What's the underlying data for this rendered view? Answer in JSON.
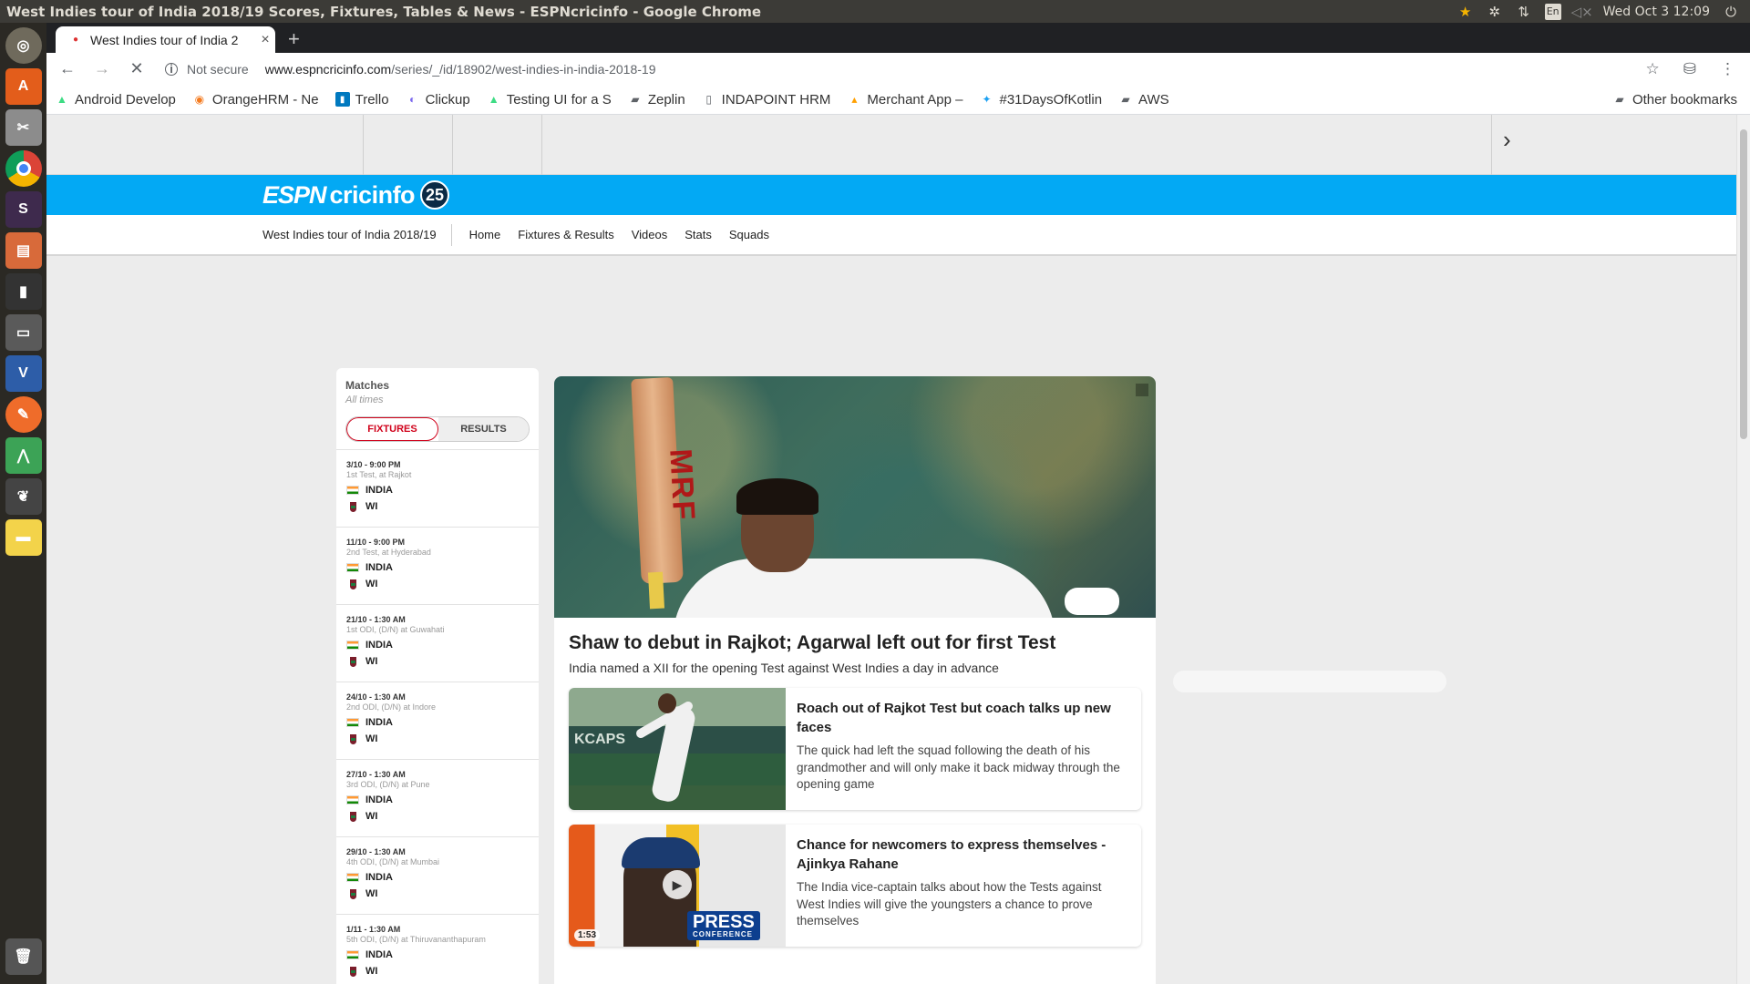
{
  "window_title": "West Indies tour of India 2018/19 Scores, Fixtures, Tables & News - ESPNcricinfo - Google Chrome",
  "system_tray": {
    "lang": "En",
    "clock": "Wed Oct  3 12:09"
  },
  "browser": {
    "tab_title": "West Indies tour of India 2",
    "security_label": "Not secure",
    "url_host": "www.espncricinfo.com",
    "url_path": "/series/_/id/18902/west-indies-in-india-2018-19",
    "bookmarks": [
      {
        "label": "Android Develop",
        "icon": "android-icon"
      },
      {
        "label": "OrangeHRM - Ne",
        "icon": "orangehrm-icon"
      },
      {
        "label": "Trello",
        "icon": "trello-icon"
      },
      {
        "label": "Clickup",
        "icon": "clickup-icon"
      },
      {
        "label": "Testing UI for a S",
        "icon": "android-icon"
      },
      {
        "label": "Zeplin",
        "icon": "folder-icon"
      },
      {
        "label": "INDAPOINT HRM",
        "icon": "page-icon"
      },
      {
        "label": "Merchant App –",
        "icon": "firebase-icon"
      },
      {
        "label": "#31DaysOfKotlin",
        "icon": "twitter-icon"
      },
      {
        "label": "AWS",
        "icon": "folder-icon"
      }
    ],
    "other_bookmarks": "Other bookmarks"
  },
  "site": {
    "brand": {
      "espn": "ESPN",
      "cricinfo": "cricinfo",
      "badge": "25"
    },
    "series_name": "West Indies tour of India 2018/19",
    "nav": [
      "Home",
      "Fixtures & Results",
      "Videos",
      "Stats",
      "Squads"
    ]
  },
  "sidebar": {
    "title": "Matches",
    "subtitle": "All times",
    "tabs": {
      "fixtures": "FIXTURES",
      "results": "RESULTS"
    },
    "matches": [
      {
        "time": "3/10 - 9:00 PM",
        "desc": "1st Test, at Rajkot",
        "team1": "INDIA",
        "team2": "WI"
      },
      {
        "time": "11/10 - 9:00 PM",
        "desc": "2nd Test, at Hyderabad",
        "team1": "INDIA",
        "team2": "WI"
      },
      {
        "time": "21/10 - 1:30 AM",
        "desc": "1st ODI, (D/N) at Guwahati",
        "team1": "INDIA",
        "team2": "WI"
      },
      {
        "time": "24/10 - 1:30 AM",
        "desc": "2nd ODI, (D/N) at Indore",
        "team1": "INDIA",
        "team2": "WI"
      },
      {
        "time": "27/10 - 1:30 AM",
        "desc": "3rd ODI, (D/N) at Pune",
        "team1": "INDIA",
        "team2": "WI"
      },
      {
        "time": "29/10 - 1:30 AM",
        "desc": "4th ODI, (D/N) at Mumbai",
        "team1": "INDIA",
        "team2": "WI"
      },
      {
        "time": "1/11 - 1:30 AM",
        "desc": "5th ODI, (D/N) at Thiruvananthapuram",
        "team1": "INDIA",
        "team2": "WI"
      }
    ]
  },
  "story": {
    "hero_bat_text": "MRF",
    "headline": "Shaw to debut in Rajkot; Agarwal left out for first Test",
    "summary": "India named a XII for the opening Test against West Indies a day in advance",
    "cards": [
      {
        "title": "Roach out of Rajkot Test but coach talks up new faces",
        "text": "The quick had left the squad following the death of his grandmother and will only make it back midway through the opening game",
        "img_text": "KCAPS"
      },
      {
        "title": "Chance for newcomers to express themselves - Ajinkya Rahane",
        "text": "The India vice-captain talks about how the Tests against West Indies will give the youngsters a chance to prove themselves",
        "img_badge": "PRESS",
        "img_badge_sub": "CONFERENCE",
        "duration": "1:53"
      }
    ]
  }
}
